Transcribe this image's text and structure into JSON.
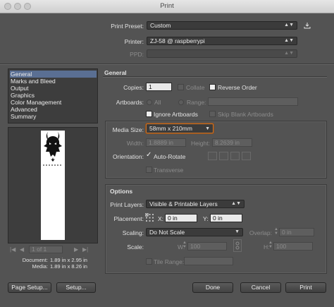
{
  "window": {
    "title": "Print"
  },
  "print_preset": {
    "label": "Print Preset:",
    "value": "Custom"
  },
  "printer": {
    "label": "Printer:",
    "value": "ZJ-58 @ raspberrypi"
  },
  "ppd": {
    "label": "PPD:",
    "value": ""
  },
  "categories": [
    {
      "label": "General",
      "selected": true
    },
    {
      "label": "Marks and Bleed"
    },
    {
      "label": "Output"
    },
    {
      "label": "Graphics"
    },
    {
      "label": "Color Management"
    },
    {
      "label": "Advanced"
    },
    {
      "label": "Summary"
    }
  ],
  "general": {
    "heading": "General",
    "copies_label": "Copies:",
    "copies_value": "1",
    "collate_label": "Collate",
    "reverse_order_label": "Reverse Order",
    "artboards_label": "Artboards:",
    "all_label": "All",
    "range_label": "Range:",
    "ignore_artboards_label": "Ignore Artboards",
    "skip_blank_label": "Skip Blank Artboards"
  },
  "media": {
    "size_label": "Media Size:",
    "size_value": "58mm x 210mm",
    "width_label": "Width:",
    "width_value": "1.8889 in",
    "height_label": "Height:",
    "height_value": "8.2639 in",
    "orientation_label": "Orientation:",
    "autorotate_label": "Auto-Rotate",
    "autorotate_mark": "✓",
    "transverse_label": "Transverse"
  },
  "options": {
    "heading": "Options",
    "print_layers_label": "Print Layers:",
    "print_layers_value": "Visible & Printable Layers",
    "placement_label": "Placement:",
    "x_label": "X:",
    "x_value": "0 in",
    "y_label": "Y:",
    "y_value": "0 in",
    "scaling_label": "Scaling:",
    "scaling_value": "Do Not Scale",
    "overlap_label": "Overlap:",
    "overlap_value": "0 in",
    "scale_label": "Scale:",
    "scale_w_label": "W:",
    "scale_w_value": "100",
    "scale_h_label": "H:",
    "scale_h_value": "100",
    "tile_range_label": "Tile Range:"
  },
  "preview": {
    "page_text": "1 of 1",
    "document_label": "Document:",
    "document_value": "1.89 in x 2.95 in",
    "media_label": "Media:",
    "media_value": "1.89 in x 8.26 in"
  },
  "buttons": {
    "page_setup": "Page Setup...",
    "setup": "Setup...",
    "done": "Done",
    "cancel": "Cancel",
    "print": "Print"
  },
  "colors": {
    "selection": "#5a6f93",
    "background": "#535353",
    "focus": "#c7742d"
  }
}
